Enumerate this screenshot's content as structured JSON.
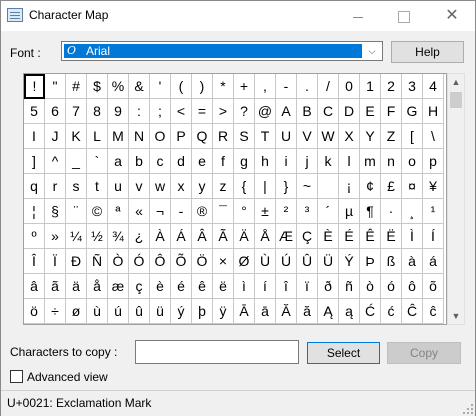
{
  "window": {
    "title": "Character Map",
    "minimize": "—",
    "maximize": "",
    "close": "✕"
  },
  "font": {
    "label": "Font :",
    "value": "Arial",
    "icon": "O"
  },
  "buttons": {
    "help": "Help",
    "select": "Select",
    "copy": "Copy"
  },
  "characters": [
    [
      "!",
      "\"",
      "#",
      "$",
      "%",
      "&",
      "'",
      "(",
      ")",
      "*",
      "+",
      ",",
      "-",
      ".",
      "/",
      "0",
      "1",
      "2",
      "3",
      "4"
    ],
    [
      "5",
      "6",
      "7",
      "8",
      "9",
      ":",
      ";",
      "<",
      "=",
      ">",
      "?",
      "@",
      "A",
      "B",
      "C",
      "D",
      "E",
      "F",
      "G",
      "H"
    ],
    [
      "I",
      "J",
      "K",
      "L",
      "M",
      "N",
      "O",
      "P",
      "Q",
      "R",
      "S",
      "T",
      "U",
      "V",
      "W",
      "X",
      "Y",
      "Z",
      "[",
      "\\"
    ],
    [
      "]",
      "^",
      "_",
      "`",
      "a",
      "b",
      "c",
      "d",
      "e",
      "f",
      "g",
      "h",
      "i",
      "j",
      "k",
      "l",
      "m",
      "n",
      "o",
      "p"
    ],
    [
      "q",
      "r",
      "s",
      "t",
      "u",
      "v",
      "w",
      "x",
      "y",
      "z",
      "{",
      "|",
      "}",
      "~",
      " ",
      "¡",
      "¢",
      "£",
      "¤",
      "¥"
    ],
    [
      "¦",
      "§",
      "¨",
      "©",
      "ª",
      "«",
      "¬",
      "-",
      "®",
      "¯",
      "°",
      "±",
      "²",
      "³",
      "´",
      "µ",
      "¶",
      "·",
      "¸",
      "¹"
    ],
    [
      "º",
      "»",
      "¼",
      "½",
      "¾",
      "¿",
      "À",
      "Á",
      "Â",
      "Ã",
      "Ä",
      "Å",
      "Æ",
      "Ç",
      "È",
      "É",
      "Ê",
      "Ë",
      "Ì",
      "Í"
    ],
    [
      "Î",
      "Ï",
      "Ð",
      "Ñ",
      "Ò",
      "Ó",
      "Ô",
      "Õ",
      "Ö",
      "×",
      "Ø",
      "Ù",
      "Ú",
      "Û",
      "Ü",
      "Ý",
      "Þ",
      "ß",
      "à",
      "á"
    ],
    [
      "â",
      "ã",
      "ä",
      "å",
      "æ",
      "ç",
      "è",
      "é",
      "ê",
      "ë",
      "ì",
      "í",
      "î",
      "ï",
      "ð",
      "ñ",
      "ò",
      "ó",
      "ô",
      "õ"
    ],
    [
      "ö",
      "÷",
      "ø",
      "ù",
      "ú",
      "û",
      "ü",
      "ý",
      "þ",
      "ÿ",
      "Ā",
      "ā",
      "Ă",
      "ă",
      "Ą",
      "ą",
      "Ć",
      "ć",
      "Ĉ",
      "ĉ"
    ]
  ],
  "copy": {
    "label": "Characters to copy :",
    "value": ""
  },
  "advanced_view": {
    "label": "Advanced view",
    "checked": false
  },
  "status": {
    "text": "U+0021: Exclamation Mark"
  },
  "selection": {
    "row": 0,
    "col": 0
  }
}
